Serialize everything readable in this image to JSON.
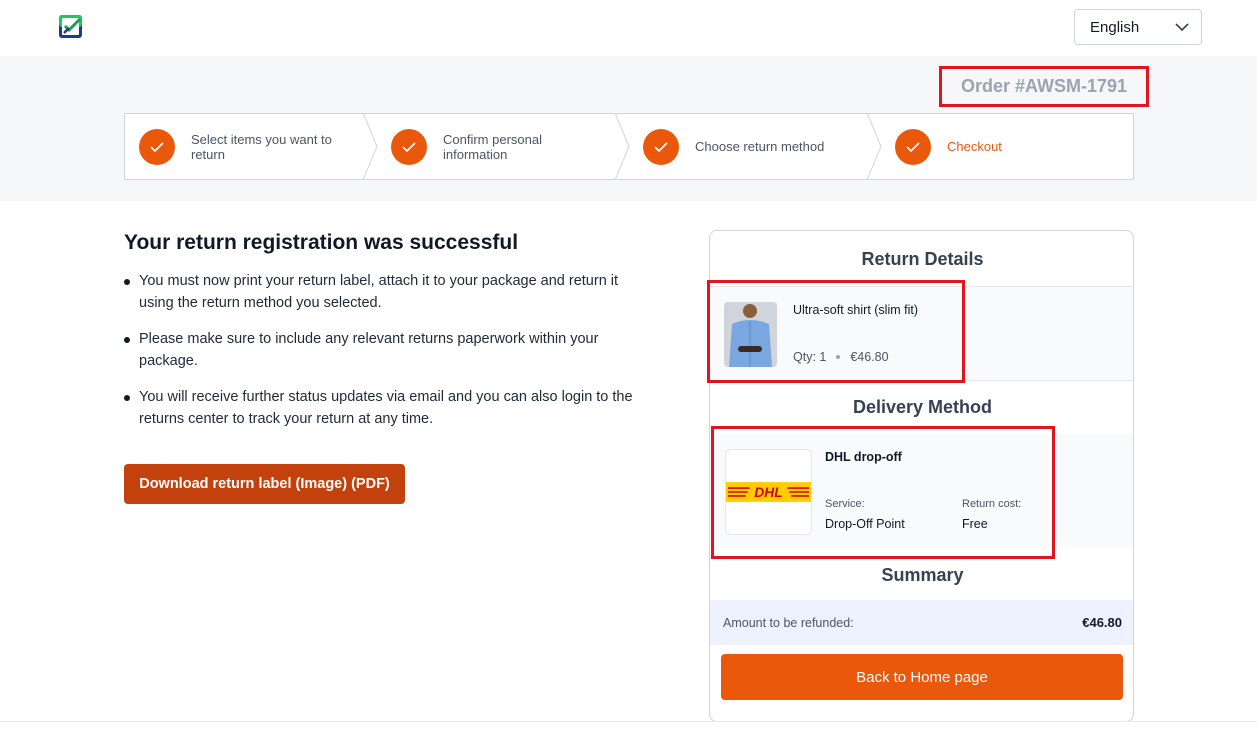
{
  "header": {
    "logo_icon": "return-checkmark-logo",
    "language": "English",
    "language_icon": "chevron-down-icon"
  },
  "order": {
    "label": "Order #AWSM-1791"
  },
  "steps": [
    {
      "label": "Select items you want to return",
      "done": true
    },
    {
      "label": "Confirm personal information",
      "done": true
    },
    {
      "label": "Choose return method",
      "done": true
    },
    {
      "label": "Checkout",
      "done": true,
      "active": true
    }
  ],
  "main": {
    "title": "Your return registration was successful",
    "bullets": [
      "You must now print your return label, attach it to your package and return it using the return method you selected.",
      "Please make sure to include any relevant returns paperwork within your package.",
      "You will receive further status updates via email and you can also login to the returns center to track your return at any time."
    ],
    "download_label": "Download return label (Image) (PDF)"
  },
  "details": {
    "return_details_heading": "Return Details",
    "item": {
      "name": "Ultra-soft shirt (slim fit)",
      "qty": "Qty: 1",
      "price": "€46.80"
    },
    "delivery_heading": "Delivery Method",
    "delivery": {
      "carrier_logo": "DHL",
      "title": "DHL drop-off",
      "service_label": "Service:",
      "service_value": "Drop-Off Point",
      "cost_label": "Return cost:",
      "cost_value": "Free"
    },
    "summary_heading": "Summary",
    "refund_label": "Amount to be refunded:",
    "refund_value": "€46.80",
    "home_button": "Back to Home page"
  },
  "colors": {
    "accent": "#ea580c",
    "download_btn": "#c2410c",
    "highlight": "#e0161e",
    "dhl_yellow": "#ffcc00",
    "dhl_red": "#d40511"
  }
}
